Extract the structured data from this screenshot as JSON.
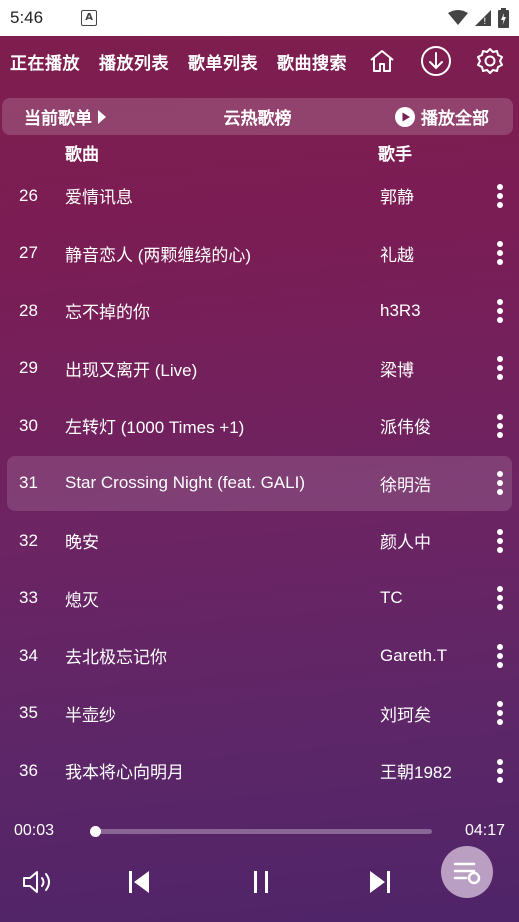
{
  "status": {
    "time": "5:46",
    "app_badge": "A"
  },
  "nav": {
    "tabs": [
      "正在播放",
      "播放列表",
      "歌单列表",
      "歌曲搜索"
    ],
    "icons": [
      "home-icon",
      "download-icon",
      "settings-icon"
    ]
  },
  "subbar": {
    "current_label": "当前歌单",
    "list_title": "云热歌榜",
    "play_all": "播放全部"
  },
  "columns": {
    "song": "歌曲",
    "singer": "歌手"
  },
  "songs": [
    {
      "num": "26",
      "title": "爱情讯息",
      "singer": "郭静"
    },
    {
      "num": "27",
      "title": "静音恋人 (两颗缠绕的心)",
      "singer": "礼越"
    },
    {
      "num": "28",
      "title": "忘不掉的你",
      "singer": "h3R3"
    },
    {
      "num": "29",
      "title": "出现又离开 (Live)",
      "singer": "梁博"
    },
    {
      "num": "30",
      "title": "左转灯 (1000 Times +1)",
      "singer": "派伟俊"
    },
    {
      "num": "31",
      "title": "Star Crossing Night (feat. GALI)",
      "singer": "徐明浩",
      "active": true
    },
    {
      "num": "32",
      "title": "晚安",
      "singer": "颜人中"
    },
    {
      "num": "33",
      "title": "熄灭",
      "singer": "TC"
    },
    {
      "num": "34",
      "title": "去北极忘记你",
      "singer": "Gareth.T"
    },
    {
      "num": "35",
      "title": "半壶纱",
      "singer": "刘珂矣"
    },
    {
      "num": "36",
      "title": "我本将心向明月",
      "singer": "王朝1982"
    }
  ],
  "player": {
    "current_time": "00:03",
    "duration": "04:17",
    "progress_fraction": 0.012
  },
  "colors": {
    "background_top": "#7f1e4e",
    "background_bottom": "#4f2468",
    "text": "#ffffff"
  }
}
